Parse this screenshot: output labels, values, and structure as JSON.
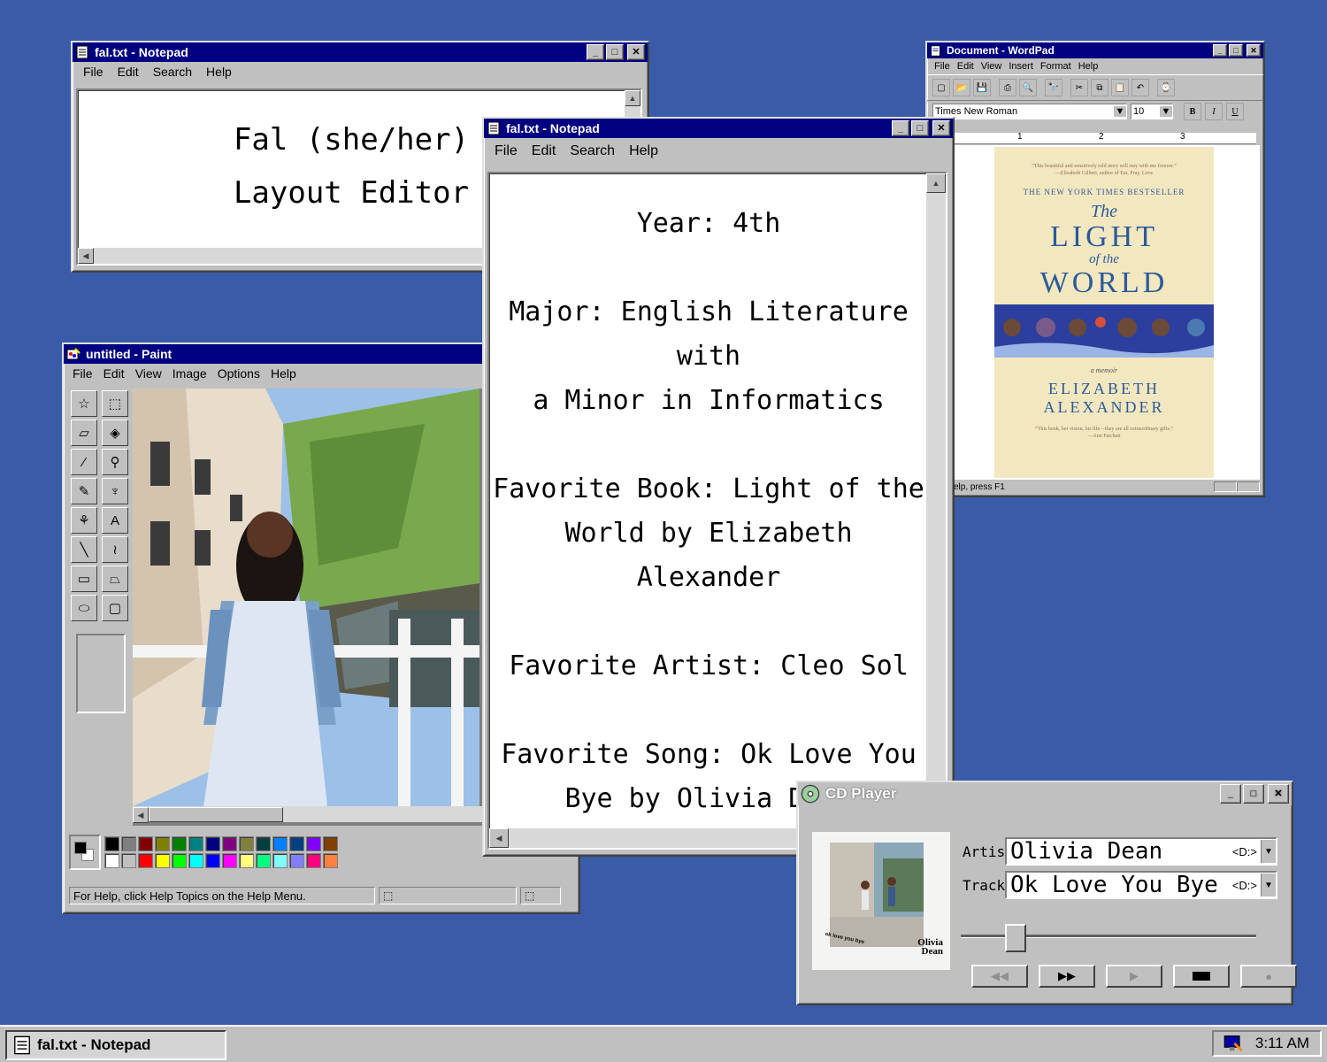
{
  "desktop": {
    "background": "#3a5ca8"
  },
  "notepad1": {
    "title": "fal.txt - Notepad",
    "menu": [
      "File",
      "Edit",
      "Search",
      "Help"
    ],
    "lines": [
      "Fal (she/her)",
      "Layout Editor"
    ]
  },
  "notepad2": {
    "title": "fal.txt - Notepad",
    "menu": [
      "File",
      "Edit",
      "Search",
      "Help"
    ],
    "year": "Year: 4th",
    "major1": "Major: English Literature with",
    "major2": "a Minor in Informatics",
    "book1": "Favorite Book: Light of the",
    "book2": "World by Elizabeth",
    "book3": "Alexander",
    "artist": "Favorite Artist: Cleo Sol",
    "song1": "Favorite Song: Ok Love You",
    "song2": "Bye by Olivia Dean"
  },
  "wordpad": {
    "title": "Document - WordPad",
    "menu": [
      "File",
      "Edit",
      "View",
      "Insert",
      "Format",
      "Help"
    ],
    "font": "Times New Roman",
    "size": "10",
    "bold": "B",
    "italic": "I",
    "underline": "U",
    "ruler": [
      "1",
      "2",
      "3"
    ],
    "status": "elp, press F1",
    "cover": {
      "quote_top": "“This beautiful and sensitively told story will stay with me forever.”",
      "quote_top_attr": "—Elizabeth Gilbert, author of Eat, Pray, Love",
      "bestseller": "THE NEW YORK TIMES BESTSELLER",
      "the": "The",
      "light": "LIGHT",
      "of_the": "of the",
      "world": "WORLD",
      "memoir": "a memoir",
      "author1": "ELIZABETH",
      "author2": "ALEXANDER",
      "quote_bottom": "“This book, her vision, his life—they are all extraordinary gifts.”",
      "quote_bottom_attr": "—Ann Patchett"
    }
  },
  "paint": {
    "title": "untitled - Paint",
    "menu": [
      "File",
      "Edit",
      "View",
      "Image",
      "Options",
      "Help"
    ],
    "status": "For Help, click Help Topics on the Help Menu.",
    "palette_top": [
      "#000000",
      "#808080",
      "#800000",
      "#808000",
      "#008000",
      "#008080",
      "#000080",
      "#800080",
      "#808040",
      "#004040",
      "#0080ff",
      "#004080",
      "#8000ff",
      "#804000"
    ],
    "palette_bottom": [
      "#ffffff",
      "#c0c0c0",
      "#ff0000",
      "#ffff00",
      "#00ff00",
      "#00ffff",
      "#0000ff",
      "#ff00ff",
      "#ffff80",
      "#00ff80",
      "#80ffff",
      "#8080ff",
      "#ff0080",
      "#ff8040"
    ],
    "tools": [
      "star-select-icon",
      "rect-select-icon",
      "eraser-icon",
      "fill-icon",
      "eyedropper-icon",
      "magnifier-icon",
      "pencil-icon",
      "brush-icon",
      "airbrush-icon",
      "text-icon",
      "line-icon",
      "curve-icon",
      "rectangle-icon",
      "polygon-icon",
      "ellipse-icon",
      "rounded-rect-icon"
    ]
  },
  "cdplayer": {
    "title": "CD Player",
    "artist_label": "Artist:",
    "artist": "Olivia Dean",
    "track_label": "Track:",
    "track": "Ok Love You Bye",
    "drive": "<D:>",
    "album_text": "Olivia Dean",
    "album_small": "ok love you bye",
    "progress": 0.16
  },
  "taskbar": {
    "task": "fal.txt - Notepad",
    "time": "3:11 AM"
  }
}
